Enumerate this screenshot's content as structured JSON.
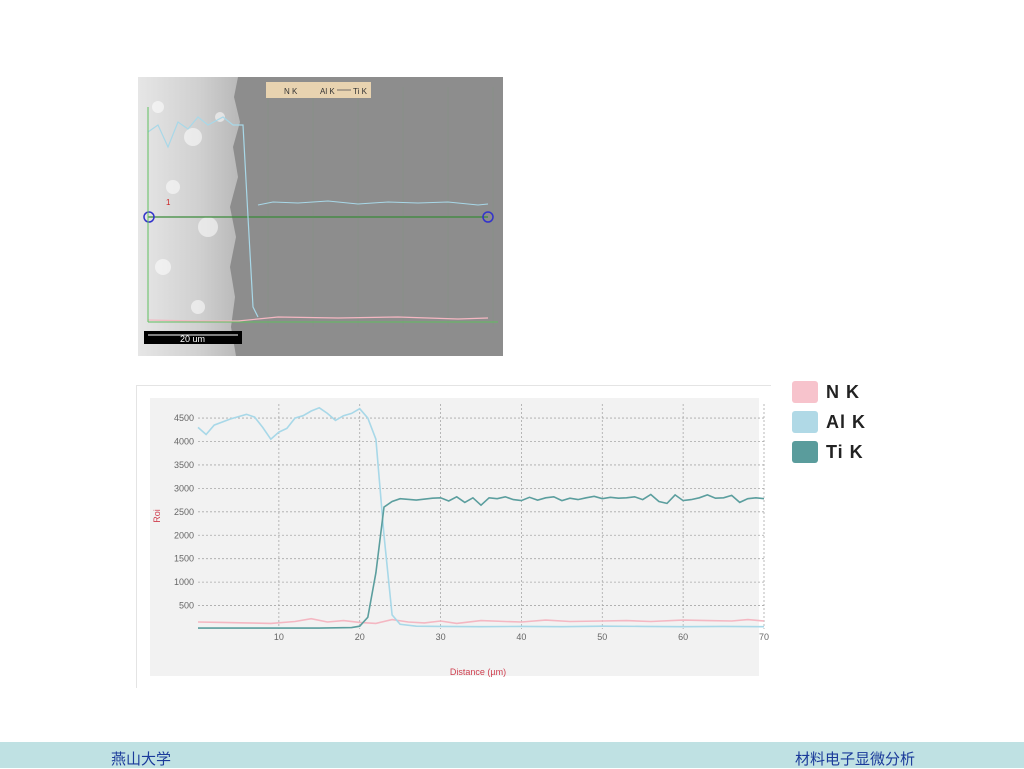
{
  "sem_image": {
    "legend": {
      "items": [
        "N  K",
        "Al K",
        "Ti K"
      ]
    },
    "scale_bar_label": "20 um",
    "marker_label": "1",
    "colors": {
      "legend_bg": "#e8d3b0",
      "line": "#3a8a3a",
      "marker": "#3333cc"
    }
  },
  "chart_data": {
    "type": "line",
    "title": "",
    "xlabel": "Distance (µm)",
    "ylabel": "Roi",
    "xlim": [
      0,
      70
    ],
    "ylim": [
      0,
      4800
    ],
    "x_ticks": [
      10,
      20,
      30,
      40,
      50,
      60,
      70
    ],
    "y_ticks": [
      500,
      1000,
      1500,
      2000,
      2500,
      3000,
      3500,
      4000,
      4500
    ],
    "grid": true,
    "series": [
      {
        "name": "N  K",
        "color": "#f4b7c2",
        "x": [
          0,
          3,
          6,
          9,
          12,
          14,
          16,
          18,
          20,
          22,
          24,
          26,
          28,
          30,
          32,
          35,
          38,
          40,
          43,
          46,
          50,
          53,
          56,
          60,
          63,
          66,
          68,
          70
        ],
        "y": [
          150,
          140,
          130,
          120,
          160,
          220,
          150,
          180,
          140,
          120,
          200,
          150,
          130,
          170,
          120,
          180,
          160,
          150,
          190,
          160,
          170,
          180,
          160,
          190,
          180,
          170,
          200,
          170
        ]
      },
      {
        "name": "Al K",
        "color": "#a8d8e8",
        "x": [
          0,
          1,
          2,
          4,
          6,
          7,
          8,
          9,
          10,
          11,
          12,
          13,
          14,
          15,
          16,
          17,
          18,
          19,
          20,
          21,
          22,
          23,
          24,
          25,
          27,
          30,
          35,
          40,
          45,
          50,
          55,
          60,
          65,
          70
        ],
        "y": [
          4300,
          4150,
          4350,
          4480,
          4580,
          4520,
          4300,
          4050,
          4200,
          4280,
          4500,
          4550,
          4650,
          4720,
          4600,
          4450,
          4550,
          4600,
          4700,
          4500,
          4050,
          2000,
          300,
          100,
          60,
          55,
          50,
          55,
          50,
          60,
          55,
          50,
          55,
          50
        ]
      },
      {
        "name": "Ti K",
        "color": "#5b9e9e",
        "x": [
          0,
          5,
          10,
          15,
          19,
          20,
          21,
          22,
          23,
          24,
          25,
          27,
          29,
          30,
          31,
          32,
          33,
          34,
          35,
          36,
          37,
          38,
          39,
          40,
          41,
          42,
          43,
          44,
          45,
          46,
          47,
          48,
          49,
          50,
          51,
          52,
          53,
          54,
          55,
          56,
          57,
          58,
          59,
          60,
          61,
          62,
          63,
          64,
          65,
          66,
          67,
          68,
          69,
          70
        ],
        "y": [
          20,
          20,
          20,
          20,
          30,
          60,
          250,
          1200,
          2600,
          2720,
          2780,
          2750,
          2790,
          2800,
          2730,
          2820,
          2700,
          2800,
          2640,
          2800,
          2780,
          2820,
          2760,
          2740,
          2810,
          2750,
          2800,
          2820,
          2740,
          2790,
          2760,
          2800,
          2830,
          2780,
          2810,
          2790,
          2800,
          2820,
          2760,
          2870,
          2720,
          2680,
          2860,
          2740,
          2760,
          2800,
          2860,
          2790,
          2800,
          2850,
          2700,
          2780,
          2800,
          2780
        ]
      }
    ]
  },
  "legend": {
    "items": [
      {
        "label": "N  K",
        "color": "#f7c3cc"
      },
      {
        "label": "Al K",
        "color": "#b0d9e6"
      },
      {
        "label": "Ti K",
        "color": "#5a9c9c"
      }
    ]
  },
  "footer": {
    "left": "燕山大学",
    "right": "材料电子显微分析",
    "bg": "#bfe1e3"
  }
}
